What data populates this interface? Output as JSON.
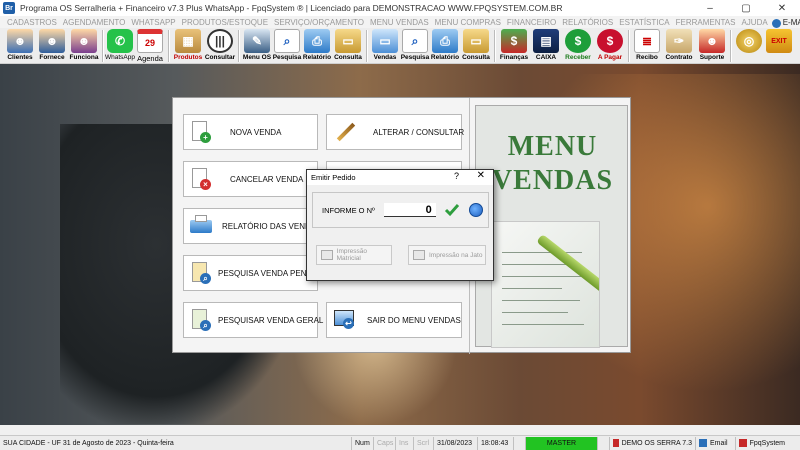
{
  "window": {
    "title": "Programa OS Serralheria + Financeiro v7.3 Plus WhatsApp - FpqSystem ® | Licenciado para  DEMONSTRACAO WWW.FPQSYSTEM.COM.BR",
    "logo_text": "Br",
    "controls": {
      "minimize": "–",
      "maximize": "▢",
      "close": "✕"
    }
  },
  "menu": {
    "items": [
      "CADASTROS",
      "AGENDAMENTO",
      "WHATSAPP",
      "PRODUTOS/ESTOQUE",
      "SERVIÇO/ORÇAMENTO",
      "MENU VENDAS",
      "MENU COMPRAS",
      "FINANCEIRO",
      "RELATÓRIOS",
      "ESTATÍSTICA",
      "FERRAMENTAS",
      "AJUDA"
    ],
    "email": "E-MAIL"
  },
  "toolbar": {
    "clientes": "Clientes",
    "fornece": "Fornece",
    "funciona": "Funciona",
    "whatsapp": "WhatsApp",
    "agenda": "Agenda",
    "agenda_day": "29",
    "produtos": "Produtos",
    "consultar": "Consultar",
    "menu_os": "Menu OS",
    "pesquisa_os": "Pesquisa",
    "relatorio_os": "Relatório",
    "consulta_os": "Consulta",
    "vendas": "Vendas",
    "pesquisa_v": "Pesquisa",
    "relatorio_v": "Relatório",
    "consulta_v": "Consulta",
    "financas": "Finanças",
    "caixa": "CAIXA",
    "receber": "Receber",
    "a_pagar": "A Pagar",
    "recibo": "Recibo",
    "contrato": "Contrato",
    "suporte": "Suporte",
    "exit_text": "EXIT"
  },
  "menu_vendas": {
    "nova_venda": "NOVA VENDA",
    "alterar_consultar": "ALTERAR / CONSULTAR",
    "cancelar_venda": "CANCELAR VENDA",
    "relatorio_vendas": "RELATÓRIO DAS VENDAS",
    "pesquisa_pendente": "PESQUISA VENDA PENDENTE",
    "pesquisar_geral": "PESQUISAR VENDA GERAL",
    "sair": "SAIR DO MENU VENDAS",
    "panel_title": "MENU VENDAS"
  },
  "dialog": {
    "title": "Emitir Pedido",
    "help": "?",
    "close": "✕",
    "label": "INFORME O Nº",
    "value": "0",
    "matricial": "Impressão Matricial",
    "jato": "Impressão na Jato"
  },
  "status": {
    "cidade": "SUA CIDADE - UF 31 de Agosto de 2023 - Quinta-feira",
    "num": "Num",
    "caps": "Caps",
    "ins": "Ins",
    "scrl": "Scrl",
    "date": "31/08/2023",
    "time": "18:08:43",
    "master": "MASTER",
    "empresa": "DEMO OS SERRA 7.3",
    "email": "Email",
    "brand": "FpqSystem"
  },
  "colors": {
    "accent_green": "#3a7a3a",
    "master_green": "#22c322",
    "title_bg": "#ffffff"
  }
}
